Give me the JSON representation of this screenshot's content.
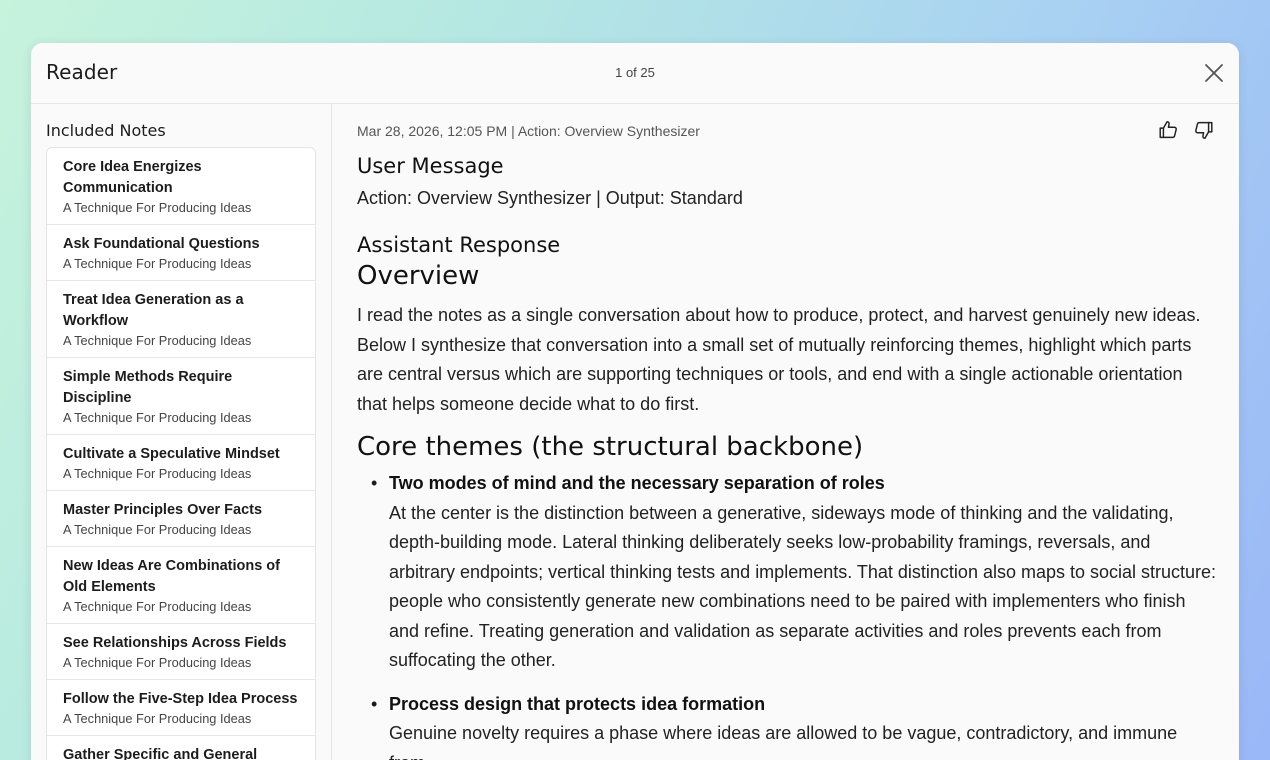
{
  "header": {
    "title": "Reader",
    "pager": "1 of 25"
  },
  "sidebar": {
    "title": "Included Notes",
    "notes": [
      {
        "title": "Core Idea Energizes Communication",
        "subtitle": "A Technique For Producing Ideas"
      },
      {
        "title": "Ask Foundational Questions",
        "subtitle": "A Technique For Producing Ideas"
      },
      {
        "title": "Treat Idea Generation as a Workflow",
        "subtitle": "A Technique For Producing Ideas"
      },
      {
        "title": "Simple Methods Require Discipline",
        "subtitle": "A Technique For Producing Ideas"
      },
      {
        "title": "Cultivate a Speculative Mindset",
        "subtitle": "A Technique For Producing Ideas"
      },
      {
        "title": "Master Principles Over Facts",
        "subtitle": "A Technique For Producing Ideas"
      },
      {
        "title": "New Ideas Are Combinations of Old Elements",
        "subtitle": "A Technique For Producing Ideas"
      },
      {
        "title": "See Relationships Across Fields",
        "subtitle": "A Technique For Producing Ideas"
      },
      {
        "title": "Follow the Five-Step Idea Process",
        "subtitle": "A Technique For Producing Ideas"
      },
      {
        "title": "Gather Specific and General",
        "subtitle": ""
      }
    ]
  },
  "main": {
    "meta": "Mar 28, 2026, 12:05 PM | Action: Overview Synthesizer",
    "user_message_heading": "User Message",
    "user_message": "Action: Overview Synthesizer | Output: Standard",
    "assistant_heading": "Assistant Response",
    "overview_heading": "Overview",
    "overview_text": "I read the notes as a single conversation about how to produce, protect, and harvest genuinely new ideas. Below I synthesize that conversation into a small set of mutually reinforcing themes, highlight which parts are central versus which are supporting techniques or tools, and end with a single actionable orientation that helps someone decide what to do first.",
    "core_heading": "Core themes (the structural backbone)",
    "themes": [
      {
        "title": "Two modes of mind and the necessary separation of roles",
        "body": "At the center is the distinction between a generative, sideways mode of thinking and the validating, depth-building mode. Lateral thinking deliberately seeks low-probability framings, reversals, and arbitrary endpoints; vertical thinking tests and implements. That distinction also maps to social structure: people who consistently generate new combinations need to be paired with implementers who finish and refine. Treating generation and validation as separate activities and roles prevents each from suffocating the other."
      },
      {
        "title": "Process design that protects idea formation",
        "body": "Genuine novelty requires a phase where ideas are allowed to be vague, contradictory, and immune from"
      }
    ]
  }
}
